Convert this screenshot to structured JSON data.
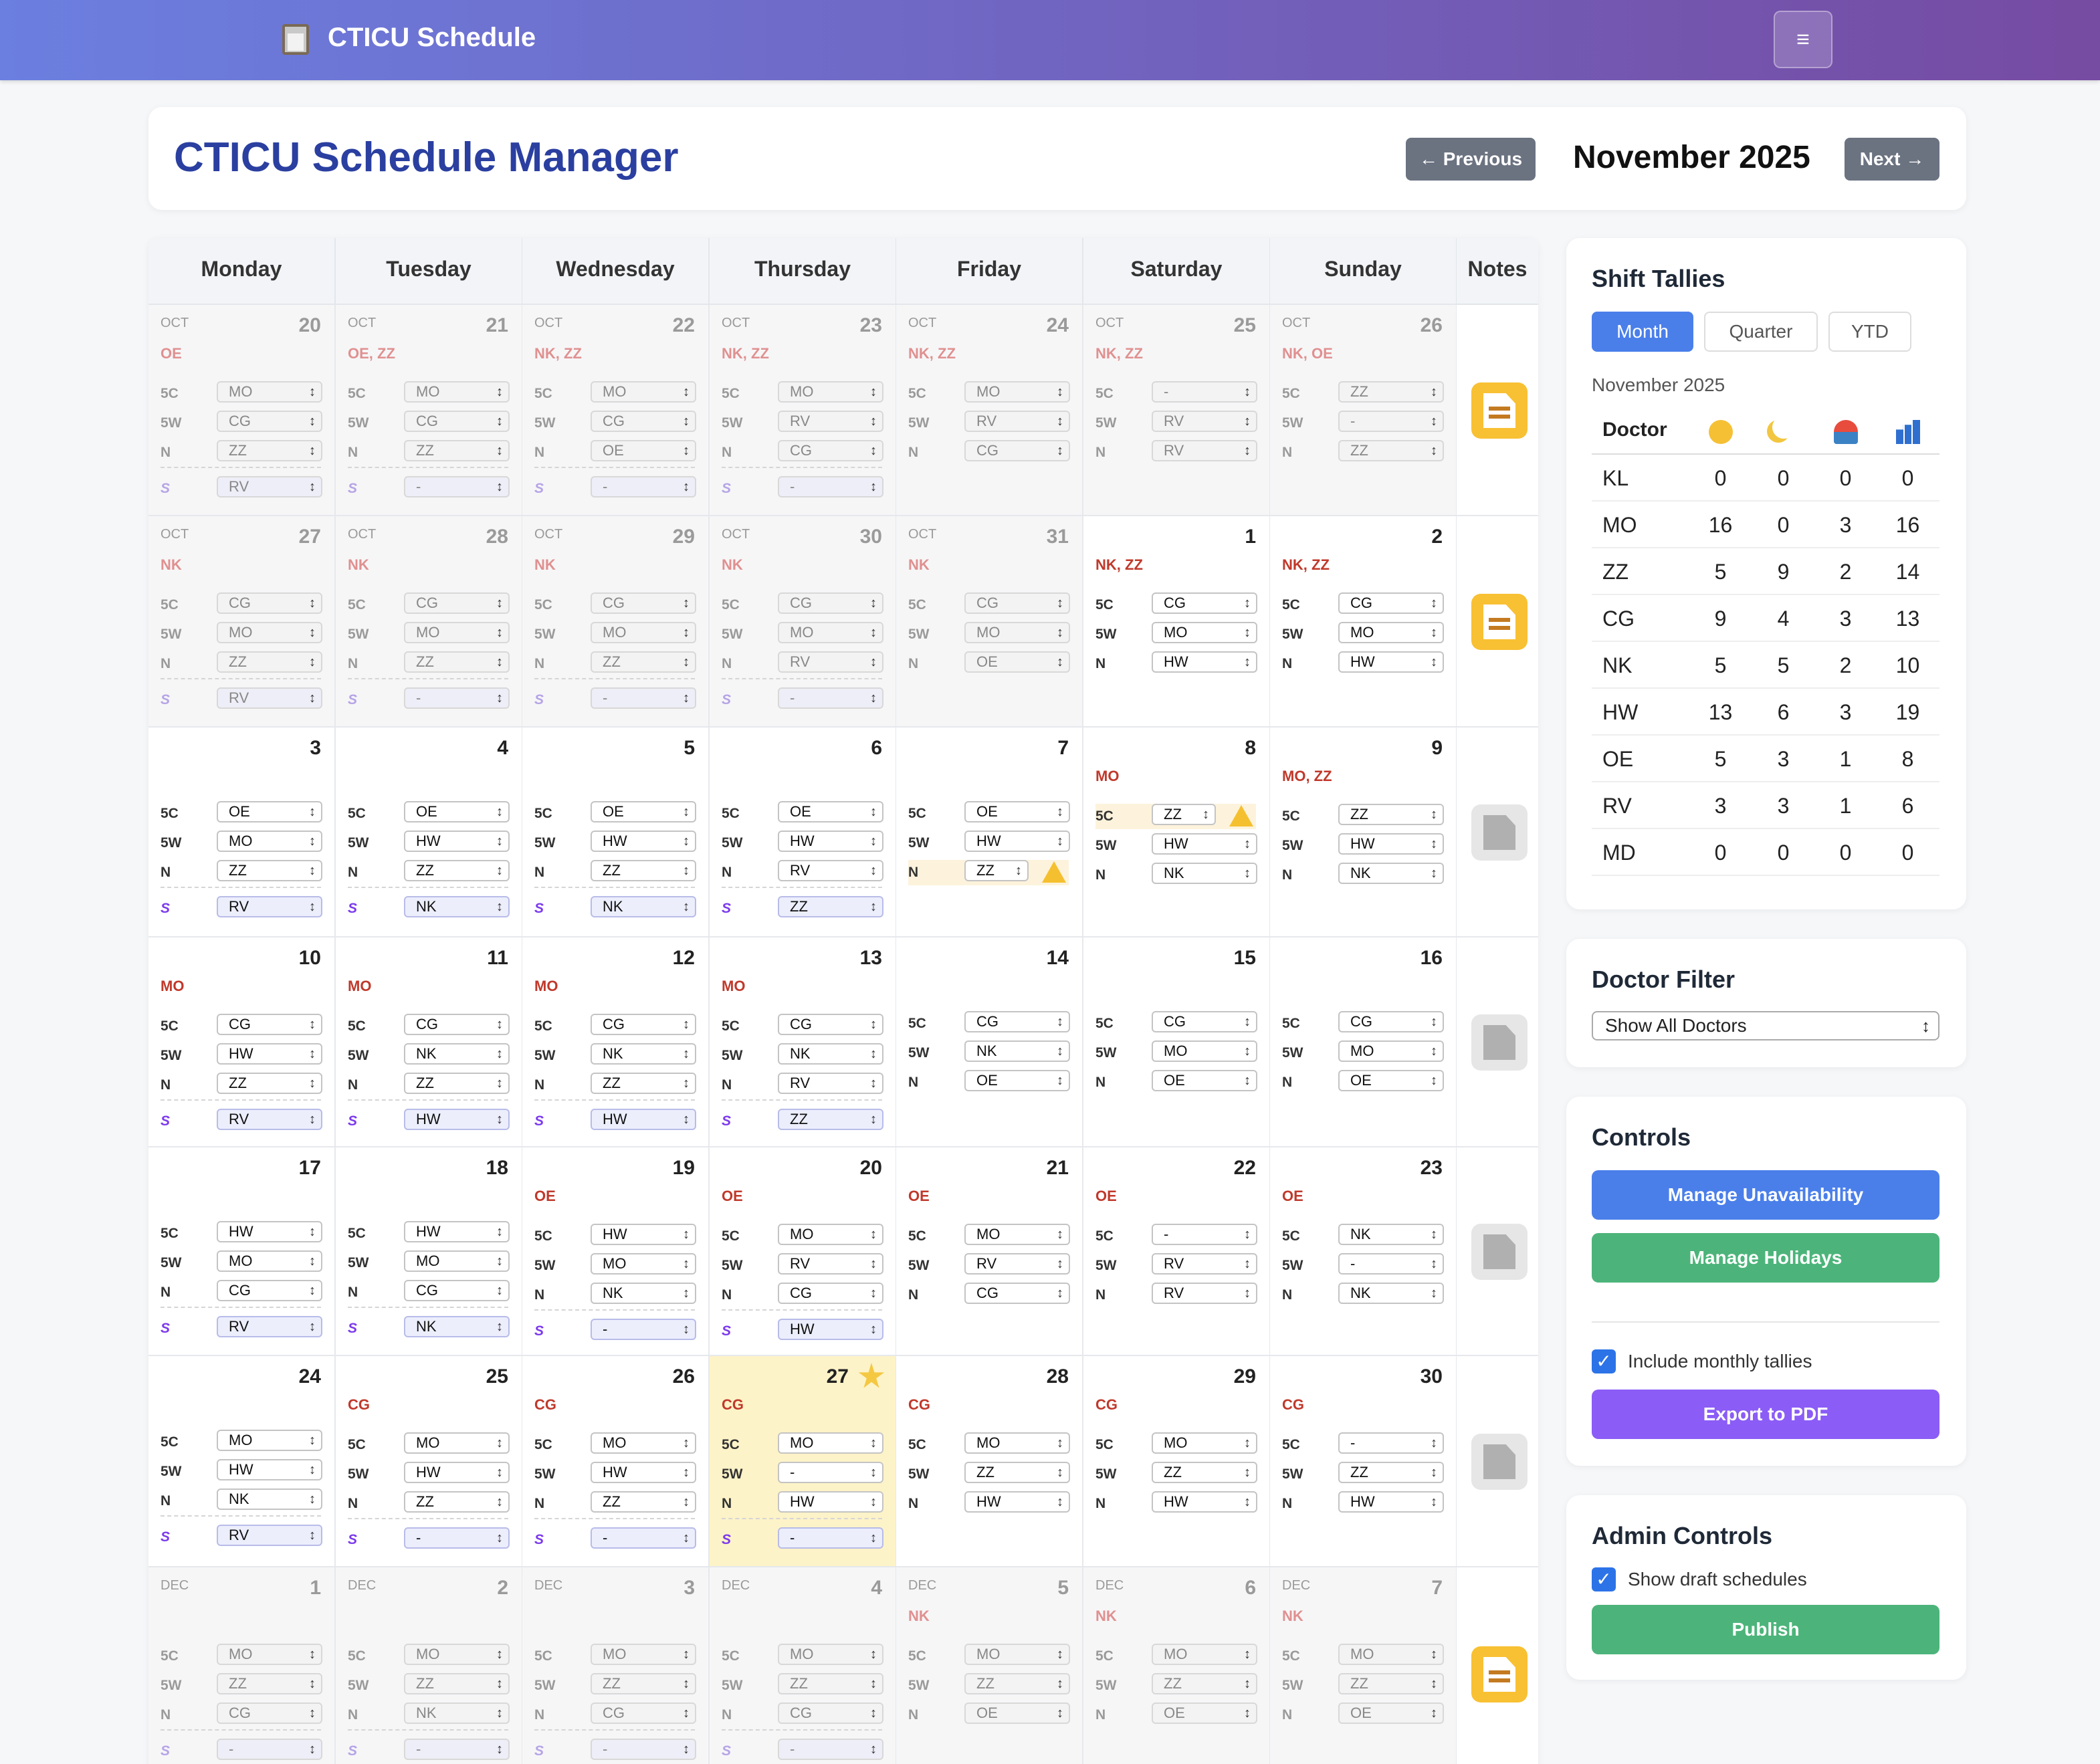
{
  "app": {
    "title": "CTICU Schedule",
    "menu_glyph": "≡"
  },
  "header": {
    "title": "CTICU Schedule Manager",
    "prev_label": "← Previous",
    "next_label": "Next →",
    "month_label": "November 2025"
  },
  "calendar": {
    "weekdays": [
      "Monday",
      "Tuesday",
      "Wednesday",
      "Thursday",
      "Friday",
      "Saturday",
      "Sunday"
    ],
    "notes_header": "Notes",
    "shift_labels": [
      "5C",
      "5W",
      "N",
      "S"
    ],
    "weeks": [
      {
        "note": "filled",
        "days": [
          {
            "mon": "OCT",
            "day": "20",
            "other": true,
            "unavail": "OE",
            "shifts": [
              "MO",
              "CG",
              "ZZ"
            ],
            "s": "RV"
          },
          {
            "mon": "OCT",
            "day": "21",
            "other": true,
            "unavail": "OE, ZZ",
            "shifts": [
              "MO",
              "CG",
              "ZZ"
            ],
            "s": "-"
          },
          {
            "mon": "OCT",
            "day": "22",
            "other": true,
            "unavail": "NK, ZZ",
            "shifts": [
              "MO",
              "CG",
              "OE"
            ],
            "s": "-"
          },
          {
            "mon": "OCT",
            "day": "23",
            "other": true,
            "unavail": "NK, ZZ",
            "shifts": [
              "MO",
              "RV",
              "CG"
            ],
            "s": "-"
          },
          {
            "mon": "OCT",
            "day": "24",
            "other": true,
            "unavail": "NK, ZZ",
            "shifts": [
              "MO",
              "RV",
              "CG"
            ]
          },
          {
            "mon": "OCT",
            "day": "25",
            "other": true,
            "unavail": "NK, ZZ",
            "shifts": [
              "-",
              "RV",
              "RV"
            ]
          },
          {
            "mon": "OCT",
            "day": "26",
            "other": true,
            "unavail": "NK, OE",
            "shifts": [
              "ZZ",
              "-",
              "ZZ"
            ]
          }
        ]
      },
      {
        "note": "filled",
        "days": [
          {
            "mon": "OCT",
            "day": "27",
            "other": true,
            "unavail": "NK",
            "shifts": [
              "CG",
              "MO",
              "ZZ"
            ],
            "s": "RV"
          },
          {
            "mon": "OCT",
            "day": "28",
            "other": true,
            "unavail": "NK",
            "shifts": [
              "CG",
              "MO",
              "ZZ"
            ],
            "s": "-"
          },
          {
            "mon": "OCT",
            "day": "29",
            "other": true,
            "unavail": "NK",
            "shifts": [
              "CG",
              "MO",
              "ZZ"
            ],
            "s": "-"
          },
          {
            "mon": "OCT",
            "day": "30",
            "other": true,
            "unavail": "NK",
            "shifts": [
              "CG",
              "MO",
              "RV"
            ],
            "s": "-"
          },
          {
            "mon": "OCT",
            "day": "31",
            "other": true,
            "unavail": "NK",
            "shifts": [
              "CG",
              "MO",
              "OE"
            ]
          },
          {
            "day": "1",
            "unavail": "NK, ZZ",
            "shifts": [
              "CG",
              "MO",
              "HW"
            ]
          },
          {
            "day": "2",
            "unavail": "NK, ZZ",
            "shifts": [
              "CG",
              "MO",
              "HW"
            ]
          }
        ]
      },
      {
        "note": "empty",
        "days": [
          {
            "day": "3",
            "shifts": [
              "OE",
              "MO",
              "ZZ"
            ],
            "s": "RV"
          },
          {
            "day": "4",
            "shifts": [
              "OE",
              "HW",
              "ZZ"
            ],
            "s": "NK"
          },
          {
            "day": "5",
            "shifts": [
              "OE",
              "HW",
              "ZZ"
            ],
            "s": "NK"
          },
          {
            "day": "6",
            "shifts": [
              "OE",
              "HW",
              "RV"
            ],
            "s": "ZZ"
          },
          {
            "day": "7",
            "shifts": [
              "OE",
              "HW",
              "ZZ"
            ],
            "warn": 2
          },
          {
            "day": "8",
            "unavail": "MO",
            "shifts": [
              "ZZ",
              "HW",
              "NK"
            ],
            "warn": 0
          },
          {
            "day": "9",
            "unavail": "MO, ZZ",
            "shifts": [
              "ZZ",
              "HW",
              "NK"
            ]
          }
        ]
      },
      {
        "note": "empty",
        "days": [
          {
            "day": "10",
            "unavail": "MO",
            "shifts": [
              "CG",
              "HW",
              "ZZ"
            ],
            "s": "RV"
          },
          {
            "day": "11",
            "unavail": "MO",
            "shifts": [
              "CG",
              "NK",
              "ZZ"
            ],
            "s": "HW"
          },
          {
            "day": "12",
            "unavail": "MO",
            "shifts": [
              "CG",
              "NK",
              "ZZ"
            ],
            "s": "HW"
          },
          {
            "day": "13",
            "unavail": "MO",
            "shifts": [
              "CG",
              "NK",
              "RV"
            ],
            "s": "ZZ"
          },
          {
            "day": "14",
            "shifts": [
              "CG",
              "NK",
              "OE"
            ]
          },
          {
            "day": "15",
            "shifts": [
              "CG",
              "MO",
              "OE"
            ]
          },
          {
            "day": "16",
            "shifts": [
              "CG",
              "MO",
              "OE"
            ]
          }
        ]
      },
      {
        "note": "empty",
        "days": [
          {
            "day": "17",
            "shifts": [
              "HW",
              "MO",
              "CG"
            ],
            "s": "RV"
          },
          {
            "day": "18",
            "shifts": [
              "HW",
              "MO",
              "CG"
            ],
            "s": "NK"
          },
          {
            "day": "19",
            "unavail": "OE",
            "shifts": [
              "HW",
              "MO",
              "NK"
            ],
            "s": "-"
          },
          {
            "day": "20",
            "unavail": "OE",
            "shifts": [
              "MO",
              "RV",
              "CG"
            ],
            "s": "HW"
          },
          {
            "day": "21",
            "unavail": "OE",
            "shifts": [
              "MO",
              "RV",
              "CG"
            ]
          },
          {
            "day": "22",
            "unavail": "OE",
            "shifts": [
              "-",
              "RV",
              "RV"
            ]
          },
          {
            "day": "23",
            "unavail": "OE",
            "shifts": [
              "NK",
              "-",
              "NK"
            ]
          }
        ]
      },
      {
        "note": "empty",
        "days": [
          {
            "day": "24",
            "shifts": [
              "MO",
              "HW",
              "NK"
            ],
            "s": "RV"
          },
          {
            "day": "25",
            "unavail": "CG",
            "shifts": [
              "MO",
              "HW",
              "ZZ"
            ],
            "s": "-"
          },
          {
            "day": "26",
            "unavail": "CG",
            "shifts": [
              "MO",
              "HW",
              "ZZ"
            ],
            "s": "-"
          },
          {
            "day": "27",
            "today": true,
            "unavail": "CG",
            "shifts": [
              "MO",
              "-",
              "HW"
            ],
            "s": "-"
          },
          {
            "day": "28",
            "unavail": "CG",
            "shifts": [
              "MO",
              "ZZ",
              "HW"
            ]
          },
          {
            "day": "29",
            "unavail": "CG",
            "shifts": [
              "MO",
              "ZZ",
              "HW"
            ]
          },
          {
            "day": "30",
            "unavail": "CG",
            "shifts": [
              "-",
              "ZZ",
              "HW"
            ]
          }
        ]
      },
      {
        "note": "filled",
        "days": [
          {
            "mon": "DEC",
            "day": "1",
            "other": true,
            "shifts": [
              "MO",
              "ZZ",
              "CG"
            ],
            "s": "-"
          },
          {
            "mon": "DEC",
            "day": "2",
            "other": true,
            "shifts": [
              "MO",
              "ZZ",
              "NK"
            ],
            "s": "-"
          },
          {
            "mon": "DEC",
            "day": "3",
            "other": true,
            "shifts": [
              "MO",
              "ZZ",
              "CG"
            ],
            "s": "-"
          },
          {
            "mon": "DEC",
            "day": "4",
            "other": true,
            "shifts": [
              "MO",
              "ZZ",
              "CG"
            ],
            "s": "-"
          },
          {
            "mon": "DEC",
            "day": "5",
            "other": true,
            "unavail": "NK",
            "shifts": [
              "MO",
              "ZZ",
              "OE"
            ]
          },
          {
            "mon": "DEC",
            "day": "6",
            "other": true,
            "unavail": "NK",
            "shifts": [
              "MO",
              "ZZ",
              "OE"
            ]
          },
          {
            "mon": "DEC",
            "day": "7",
            "other": true,
            "unavail": "NK",
            "shifts": [
              "MO",
              "ZZ",
              "OE"
            ]
          }
        ]
      }
    ]
  },
  "tallies": {
    "title": "Shift Tallies",
    "tabs": [
      "Month",
      "Quarter",
      "YTD"
    ],
    "active_tab": "Month",
    "period": "November 2025",
    "doctor_header": "Doctor",
    "column_icons": [
      "sun-icon",
      "moon-icon",
      "beach-umbrella-icon",
      "bar-chart-icon"
    ],
    "rows": [
      {
        "doctor": "KL",
        "values": [
          "0",
          "0",
          "0",
          "0"
        ]
      },
      {
        "doctor": "MO",
        "values": [
          "16",
          "0",
          "3",
          "16"
        ]
      },
      {
        "doctor": "ZZ",
        "values": [
          "5",
          "9",
          "2",
          "14"
        ]
      },
      {
        "doctor": "CG",
        "values": [
          "9",
          "4",
          "3",
          "13"
        ]
      },
      {
        "doctor": "NK",
        "values": [
          "5",
          "5",
          "2",
          "10"
        ]
      },
      {
        "doctor": "HW",
        "values": [
          "13",
          "6",
          "3",
          "19"
        ]
      },
      {
        "doctor": "OE",
        "values": [
          "5",
          "3",
          "1",
          "8"
        ]
      },
      {
        "doctor": "RV",
        "values": [
          "3",
          "3",
          "1",
          "6"
        ]
      },
      {
        "doctor": "MD",
        "values": [
          "0",
          "0",
          "0",
          "0"
        ]
      }
    ]
  },
  "filter": {
    "title": "Doctor Filter",
    "selected": "Show All Doctors"
  },
  "controls": {
    "title": "Controls",
    "unavailability_label": "Manage Unavailability",
    "holidays_label": "Manage Holidays",
    "include_tallies_label": "Include monthly tallies",
    "export_label": "Export to PDF"
  },
  "admin": {
    "title": "Admin Controls",
    "draft_label": "Show draft schedules",
    "publish_label": "Publish"
  },
  "colors": {
    "brand_start": "#6b7fe0",
    "brand_end": "#764ba2",
    "primary": "#4a7fea",
    "success": "#4cb47a",
    "export": "#8b5cf6",
    "unavailable": "#c0392b",
    "today": "#fdf3c8"
  }
}
